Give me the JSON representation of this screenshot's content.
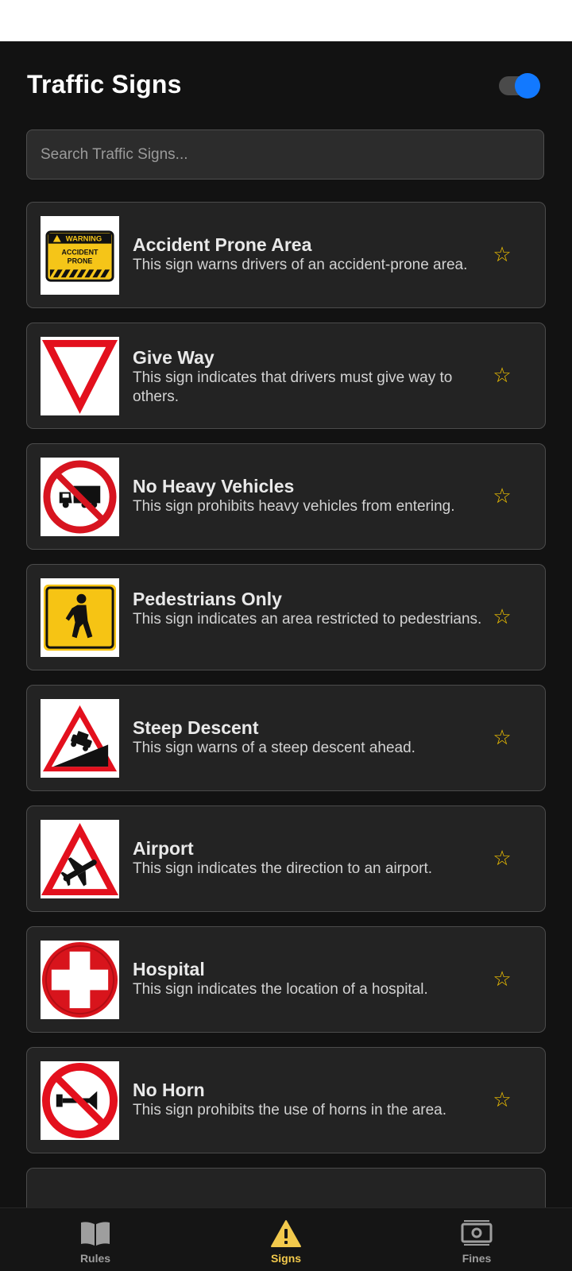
{
  "header": {
    "title": "Traffic Signs",
    "toggle_on": true
  },
  "search": {
    "placeholder": "Search Traffic Signs..."
  },
  "signs": [
    {
      "title": "Accident Prone Area",
      "description": "This sign warns drivers of an accident-prone area.",
      "icon": "accident-prone-sign",
      "favorite": false,
      "sign_text": {
        "warning": "WARNING",
        "line1": "ACCIDENT",
        "line2": "PRONE"
      }
    },
    {
      "title": "Give Way",
      "description": "This sign indicates that drivers must give way to others.",
      "icon": "give-way-sign",
      "favorite": false
    },
    {
      "title": "No Heavy Vehicles",
      "description": "This sign prohibits heavy vehicles from entering.",
      "icon": "no-heavy-vehicles-sign",
      "favorite": false
    },
    {
      "title": "Pedestrians Only",
      "description": "This sign indicates an area restricted to pedestrians.",
      "icon": "pedestrians-only-sign",
      "favorite": false
    },
    {
      "title": "Steep Descent",
      "description": "This sign warns of a steep descent ahead.",
      "icon": "steep-descent-sign",
      "favorite": false
    },
    {
      "title": "Airport",
      "description": "This sign indicates the direction to an airport.",
      "icon": "airport-sign",
      "favorite": false
    },
    {
      "title": "Hospital",
      "description": "This sign indicates the location of a hospital.",
      "icon": "hospital-sign",
      "favorite": false
    },
    {
      "title": "No Horn",
      "description": "This sign prohibits the use of horns in the area.",
      "icon": "no-horn-sign",
      "favorite": false
    }
  ],
  "star_glyph": "☆",
  "bottom_nav": [
    {
      "label": "Rules",
      "icon": "book-icon",
      "active": false
    },
    {
      "label": "Signs",
      "icon": "warning-icon",
      "active": true
    },
    {
      "label": "Fines",
      "icon": "money-icon",
      "active": false
    }
  ],
  "colors": {
    "background": "#121212",
    "card": "#232323",
    "accent_toggle": "#1279ff",
    "star": "#f2c200",
    "active_tab": "#f2c94c"
  }
}
